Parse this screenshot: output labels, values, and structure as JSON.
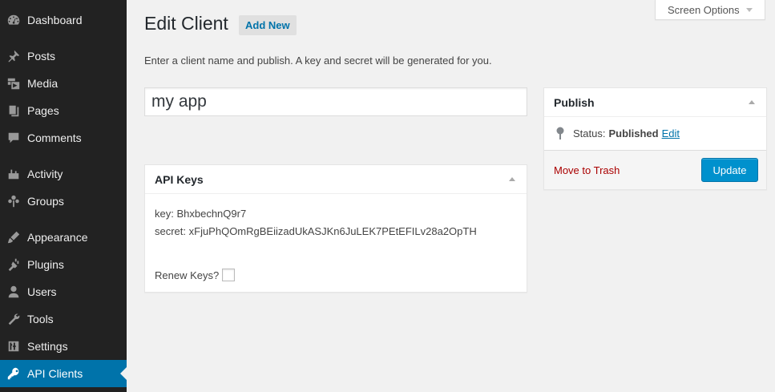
{
  "sidebar": {
    "items": [
      {
        "label": "Dashboard",
        "icon": "dashboard-icon"
      },
      {
        "label": "Posts",
        "icon": "pin-icon"
      },
      {
        "label": "Media",
        "icon": "media-icon"
      },
      {
        "label": "Pages",
        "icon": "pages-icon"
      },
      {
        "label": "Comments",
        "icon": "comments-icon"
      },
      {
        "label": "Activity",
        "icon": "activity-icon"
      },
      {
        "label": "Groups",
        "icon": "groups-icon"
      },
      {
        "label": "Appearance",
        "icon": "appearance-icon"
      },
      {
        "label": "Plugins",
        "icon": "plugins-icon"
      },
      {
        "label": "Users",
        "icon": "users-icon"
      },
      {
        "label": "Tools",
        "icon": "tools-icon"
      },
      {
        "label": "Settings",
        "icon": "settings-icon"
      },
      {
        "label": "API Clients",
        "icon": "key-icon",
        "current": true
      }
    ]
  },
  "header": {
    "screen_options": "Screen Options",
    "title": "Edit Client",
    "add_new": "Add New",
    "intro": "Enter a client name and publish. A key and secret will be generated for you."
  },
  "form": {
    "title_value": "my app"
  },
  "api_keys": {
    "heading": "API Keys",
    "key_line": "key: BhxbechnQ9r7",
    "secret_line": "secret: xFjuPhQOmRgBEiizadUkASJKn6JuLEK7PEtEFILv28a2OpTH",
    "renew_label": "Renew Keys?"
  },
  "publish": {
    "heading": "Publish",
    "status_label": "Status:",
    "status_value": "Published",
    "edit_link": "Edit",
    "trash_link": "Move to Trash",
    "update_label": "Update"
  },
  "colors": {
    "accent": "#0073aa",
    "sidebar_bg": "#222222",
    "update_button": "#0091cd",
    "trash": "#aa0000"
  }
}
